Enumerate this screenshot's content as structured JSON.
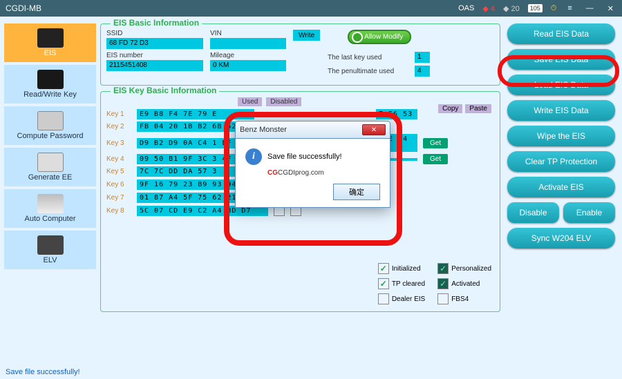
{
  "titlebar": {
    "app_name": "CGDI-MB",
    "oas_label": "OAS",
    "red_count": "4",
    "gray_count": "20",
    "date_badge": "105"
  },
  "sidebar": {
    "items": [
      {
        "label": "EIS"
      },
      {
        "label": "Read/Write Key"
      },
      {
        "label": "Compute Password"
      },
      {
        "label": "Generate EE"
      },
      {
        "label": "Auto Computer"
      },
      {
        "label": "ELV"
      }
    ]
  },
  "basic_info": {
    "legend": "EIS Basic Information",
    "ssid_label": "SSID",
    "ssid_value": "68 FD 72 D3",
    "vin_label": "VIN",
    "vin_value": "",
    "write_label": "Write",
    "eis_number_label": "EIS number",
    "eis_number_value": "2115451408",
    "mileage_label": "Mileage",
    "mileage_value": "0 KM",
    "allow_modify_label": "Allow Modify",
    "last_key_label": "The last key used",
    "last_key_value": "1",
    "penult_label": "The penultimate used",
    "penult_value": "4"
  },
  "key_info": {
    "legend": "EIS Key Basic Information",
    "hdr_used": "Used",
    "hdr_disabled": "Disabled",
    "copy_label": "Copy",
    "paste_label": "Paste",
    "get_label": "Get",
    "keys": [
      {
        "label": "Key 1",
        "data": "E9 B8 F4 7E 79 E",
        "used": true,
        "ext": "7 E6 53"
      },
      {
        "label": "Key 2",
        "data": "FB 04 20 1B B2 6B 52"
      },
      {
        "label": "Key 3",
        "data": "D9 B2 D9 0A C4 1  EF",
        "ext": "4 E F4 38"
      },
      {
        "label": "Key 4",
        "data": "09 50 B1 9F 3C 3  4F",
        "used": true
      },
      {
        "label": "Key 5",
        "data": "7C 7C DD DA 57 3"
      },
      {
        "label": "Key 6",
        "data": "9F 16 79 23 B9 93 94 69",
        "used": true
      },
      {
        "label": "Key 7",
        "data": "01 87 A4 5F 75 62 21 B1"
      },
      {
        "label": "Key 8",
        "data": "5C 07 CD E9 C2 A4 BD D7"
      }
    ],
    "status": {
      "initialized": "Initialized",
      "personalized": "Personalized",
      "tp_cleared": "TP cleared",
      "activated": "Activated",
      "dealer_eis": "Dealer EIS",
      "fbs4": "FBS4"
    }
  },
  "actions": {
    "read": "Read  EIS Data",
    "save": "Save EIS Data",
    "load": "Load EIS Data",
    "write": "Write EIS Data",
    "wipe": "Wipe the EIS",
    "clear_tp": "Clear TP Protection",
    "activate": "Activate EIS",
    "disable": "Disable",
    "enable": "Enable",
    "sync": "Sync W204 ELV"
  },
  "dialog": {
    "title": "Benz Monster",
    "message": "Save file successfully!",
    "brand": "CGDIprog",
    "brand_suffix": ".com",
    "ok_label": "确定"
  },
  "footer": {
    "status": "Save file successfully!"
  }
}
